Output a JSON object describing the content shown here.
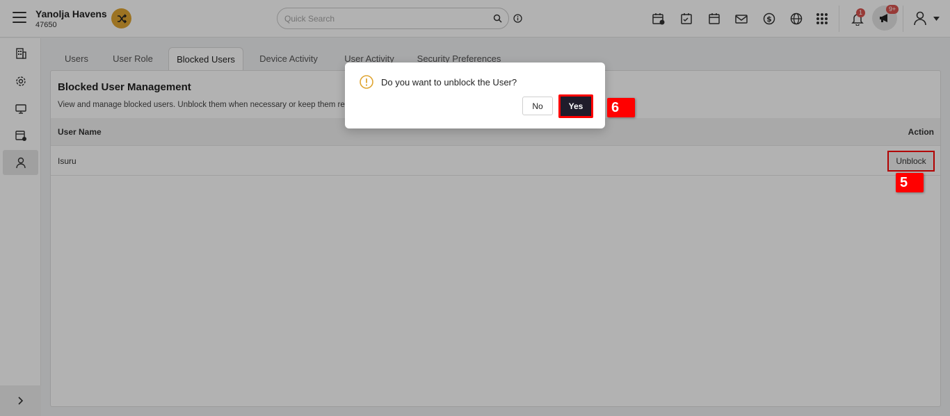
{
  "header": {
    "brand_name": "Yanolja Havens",
    "brand_id": "47650",
    "search_placeholder": "Quick Search",
    "notification_count": "1",
    "announcement_count": "9+"
  },
  "tabs": [
    {
      "label": "Users"
    },
    {
      "label": "User Role"
    },
    {
      "label": "Blocked Users"
    },
    {
      "label": "Device Activity"
    },
    {
      "label": "User Activity"
    },
    {
      "label": "Security Preferences"
    }
  ],
  "panel": {
    "title": "Blocked User Management",
    "description": "View and manage blocked users. Unblock them when necessary or keep them re",
    "columns": {
      "user_name": "User Name",
      "action": "Action"
    },
    "rows": [
      {
        "user_name": "Isuru",
        "action_label": "Unblock"
      }
    ]
  },
  "dialog": {
    "message": "Do you want to unblock the User?",
    "no_label": "No",
    "yes_label": "Yes"
  },
  "annotations": {
    "step5": "5",
    "step6": "6"
  },
  "colors": {
    "accent": "#e0a532",
    "primary_dark": "#1f1c2b",
    "highlight": "#ff0000",
    "badge": "#d9534f"
  }
}
